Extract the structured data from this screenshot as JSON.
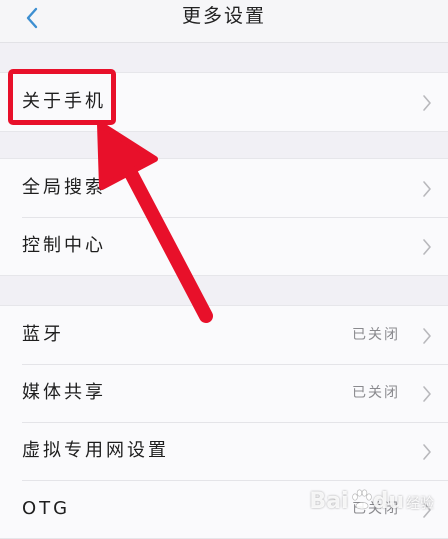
{
  "header": {
    "title": "更多设置"
  },
  "groups": [
    {
      "items": [
        {
          "label": "关于手机"
        }
      ]
    },
    {
      "items": [
        {
          "label": "全局搜索"
        },
        {
          "label": "控制中心"
        }
      ]
    },
    {
      "items": [
        {
          "label": "蓝牙",
          "value": "已关闭"
        },
        {
          "label": "媒体共享",
          "value": "已关闭"
        },
        {
          "label": "虚拟专用网设置"
        },
        {
          "label": "OTG",
          "value": "已关闭"
        }
      ]
    }
  ],
  "watermark": {
    "brand": "Bai",
    "brand_tail": "du",
    "suffix": "经验"
  },
  "colors": {
    "accent": "#3d8fd1",
    "annotation": "#e8102a",
    "background": "#f1f0f5",
    "card": "#fafafc"
  },
  "icons": {
    "back": "chevron-left-icon",
    "row": "chevron-right-icon"
  }
}
